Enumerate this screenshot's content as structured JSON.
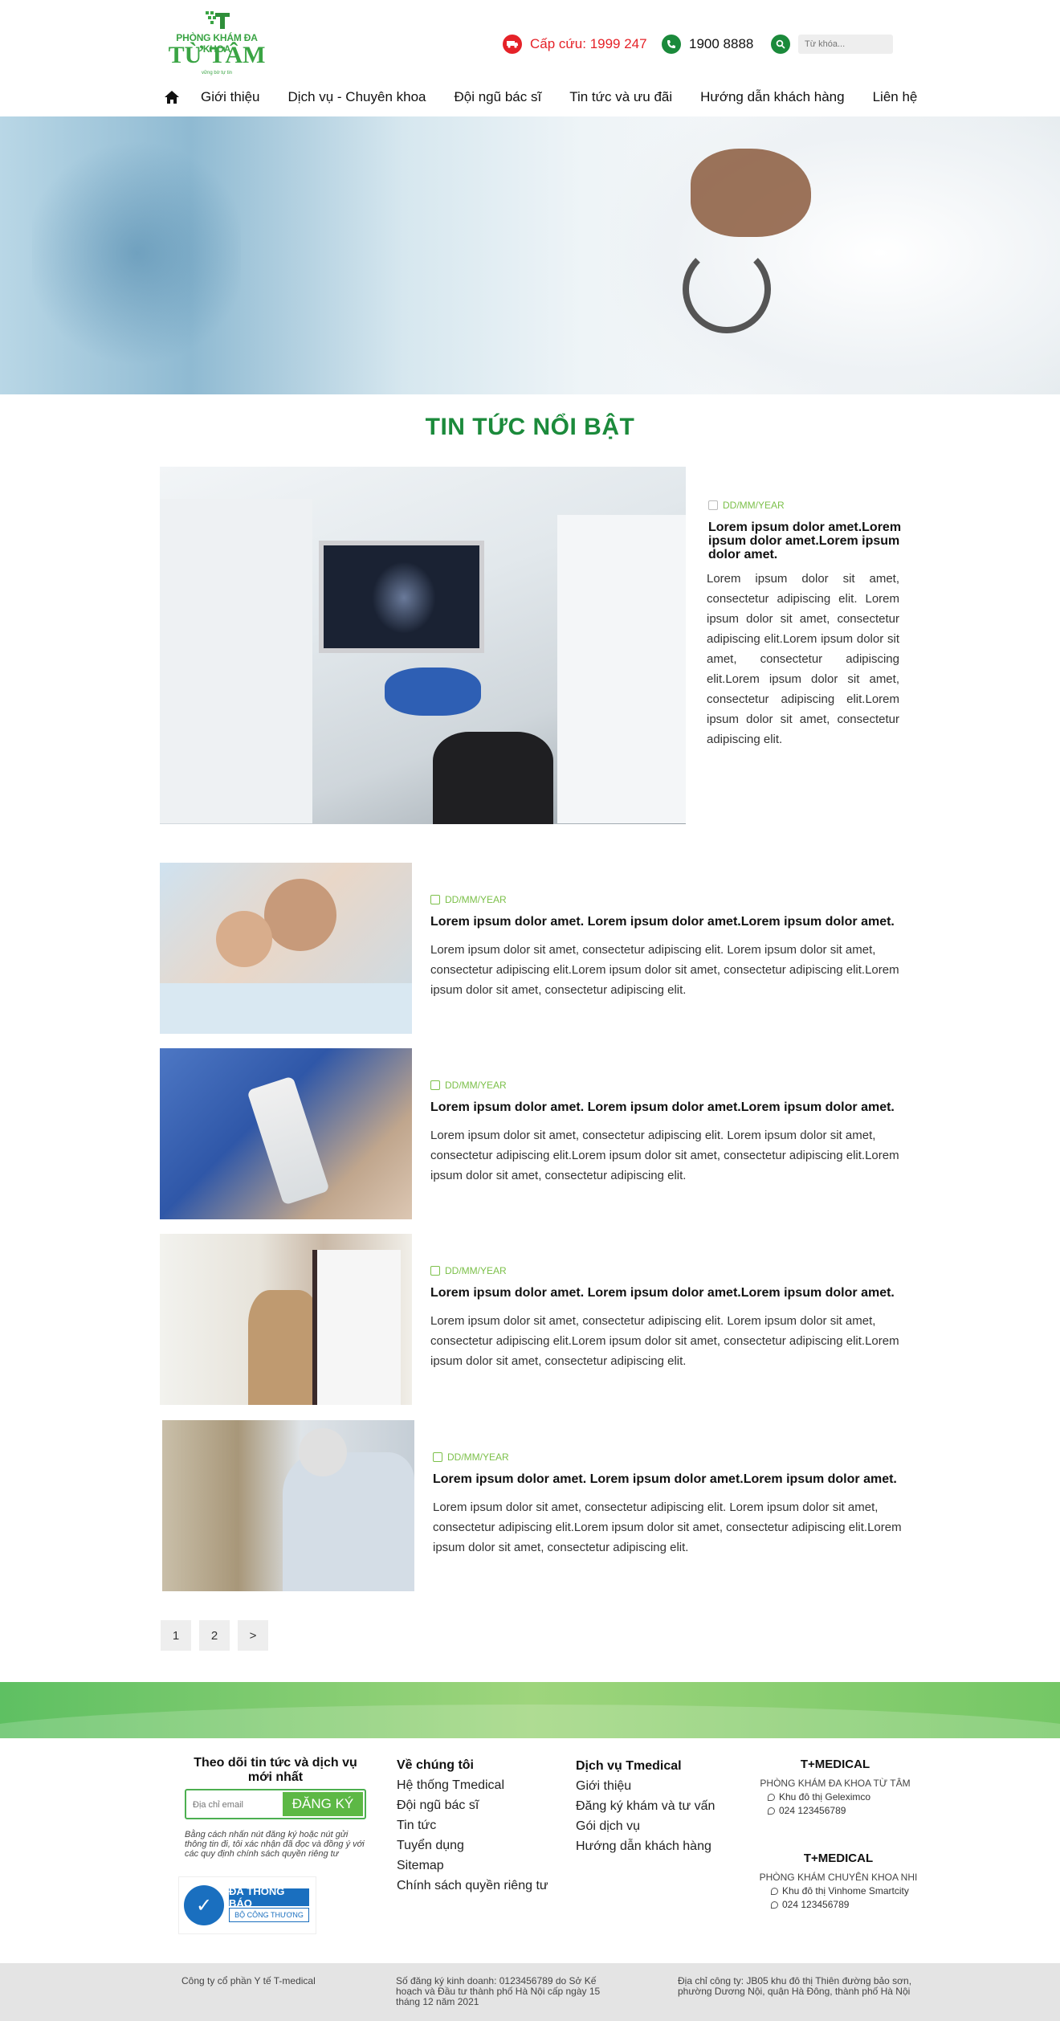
{
  "header": {
    "logo": {
      "subtitle": "PHÒNG KHÁM ĐA KHOA",
      "name": "TỪ TÂM",
      "tagline": "vững bờ tự tin"
    },
    "emergency": {
      "label": "Cấp cứu: 1999 247",
      "icon": "ambulance-icon"
    },
    "hotline": {
      "label": "1900 8888",
      "icon": "phone-icon"
    },
    "search": {
      "placeholder": "Từ khóa...",
      "icon": "search-icon"
    }
  },
  "nav": {
    "home_icon": "home-icon",
    "items": [
      "Giới thiệu",
      "Dịch vụ - Chuyên khoa",
      "Đội ngũ bác sĩ",
      "Tin tức và ưu đãi",
      "Hướng dẫn khách hàng",
      "Liên hệ"
    ]
  },
  "section_title": "TIN TỨC NỔI BẬT",
  "featured": {
    "date": "DD/MM/YEAR",
    "title": "Lorem ipsum dolor amet.Lorem ipsum dolor amet.Lorem ipsum dolor amet.",
    "body": "Lorem ipsum dolor sit amet, consectetur adipiscing elit. Lorem ipsum dolor sit amet, consectetur adipiscing elit.Lorem ipsum dolor sit amet, consectetur adipiscing elit.Lorem ipsum dolor sit amet, consectetur adipiscing elit.Lorem ipsum dolor sit amet, consectetur adipiscing elit."
  },
  "articles": [
    {
      "date": "DD/MM/YEAR",
      "title": "Lorem ipsum dolor amet. Lorem ipsum dolor amet.Lorem ipsum dolor amet.",
      "body": "Lorem ipsum dolor sit amet, consectetur adipiscing elit. Lorem ipsum dolor sit amet, consectetur adipiscing elit.Lorem ipsum dolor sit amet, consectetur adipiscing elit.Lorem ipsum dolor sit amet, consectetur adipiscing elit."
    },
    {
      "date": "DD/MM/YEAR",
      "title": "Lorem ipsum dolor amet. Lorem ipsum dolor amet.Lorem ipsum dolor amet.",
      "body": "Lorem ipsum dolor sit amet, consectetur adipiscing elit. Lorem ipsum dolor sit amet, consectetur adipiscing elit.Lorem ipsum dolor sit amet, consectetur adipiscing elit.Lorem ipsum dolor sit amet, consectetur adipiscing elit."
    },
    {
      "date": "DD/MM/YEAR",
      "title": "Lorem ipsum dolor amet. Lorem ipsum dolor amet.Lorem ipsum dolor amet.",
      "body": "Lorem ipsum dolor sit amet, consectetur adipiscing elit. Lorem ipsum dolor sit amet, consectetur adipiscing elit.Lorem ipsum dolor sit amet, consectetur adipiscing elit.Lorem ipsum dolor sit amet, consectetur adipiscing elit."
    },
    {
      "date": "DD/MM/YEAR",
      "title": "Lorem ipsum dolor amet. Lorem ipsum dolor amet.Lorem ipsum dolor amet.",
      "body": "Lorem ipsum dolor sit amet, consectetur adipiscing elit. Lorem ipsum dolor sit amet, consectetur adipiscing elit.Lorem ipsum dolor sit amet, consectetur adipiscing elit.Lorem ipsum dolor sit amet, consectetur adipiscing elit."
    }
  ],
  "pagination": [
    "1",
    "2",
    ">"
  ],
  "footer": {
    "subscribe": {
      "title": "Theo dõi tin tức và dịch vụ mới nhất",
      "placeholder": "Địa chỉ email",
      "button": "ĐĂNG KÝ",
      "disclaimer": "Bằng cách nhấn nút đăng ký hoặc nút gửi thông tin đi, tôi xác nhận đã đọc và đồng ý với các quy định chính sách quyền riêng tư",
      "badge_line1": "ĐÃ THÔNG BÁO",
      "badge_line2": "BỘ CÔNG THƯƠNG"
    },
    "about": {
      "title": "Về chúng tôi",
      "links": [
        "Hệ thống Tmedical",
        "Đội ngũ bác sĩ",
        "Tin tức",
        "Tuyển dụng",
        "Sitemap",
        "Chính sách quyền riêng tư"
      ]
    },
    "services": {
      "title": "Dịch vụ Tmedical",
      "links": [
        "Giới thiệu",
        "Đăng ký khám và tư vấn",
        "Gói dịch vụ",
        "Hướng dẫn khách hàng"
      ]
    },
    "clinics": [
      {
        "brand": "T+MEDICAL",
        "name": "PHÒNG KHÁM ĐA KHOA TỪ TÂM",
        "address": "Khu đô thị Geleximco",
        "phone": "024 123456789"
      },
      {
        "brand": "T+MEDICAL",
        "name": "PHÒNG KHÁM CHUYÊN KHOA NHI",
        "address": "Khu đô thị Vinhome Smartcity",
        "phone": "024 123456789"
      }
    ],
    "bottom": {
      "company": "Công ty cổ phần Y tế T-medical",
      "license": "Số đăng ký kinh doanh: 0123456789 do Sở Kế hoạch và Đầu tư thành phố Hà Nội cấp ngày 15 tháng 12 năm 2021",
      "address": "Địa chỉ công ty: JB05 khu đô thị Thiên đường bảo sơn, phường Dương Nội, quận Hà Đông, thành phố Hà Nội"
    }
  },
  "colors": {
    "brand_green": "#1b8a3b",
    "accent_green": "#7cc04a",
    "emergency_red": "#e52228"
  }
}
